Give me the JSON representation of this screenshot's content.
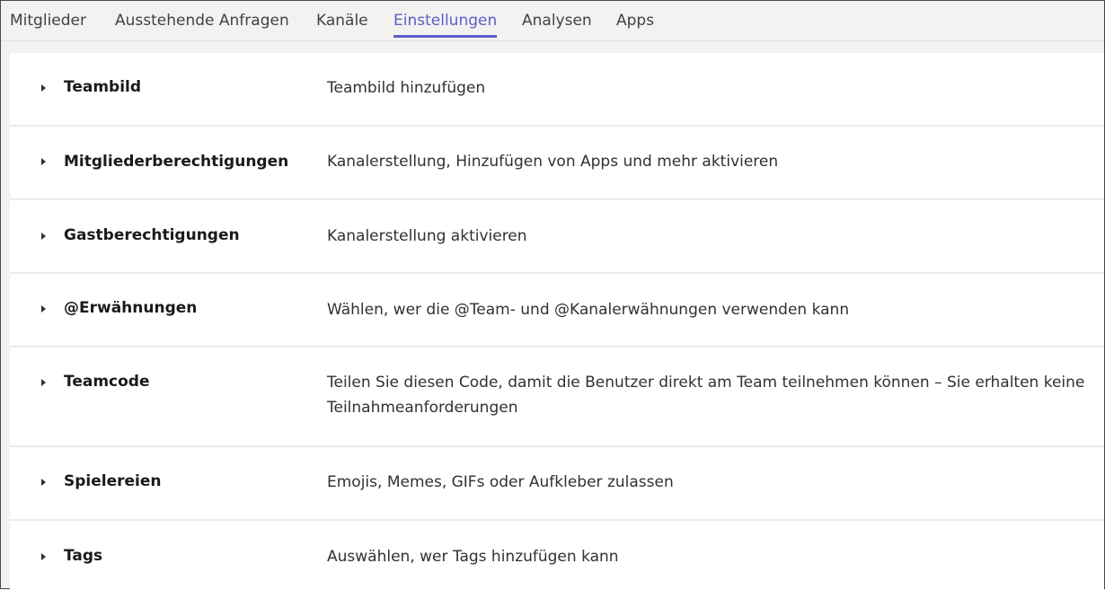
{
  "tabs": [
    {
      "label": "Mitglieder"
    },
    {
      "label": "Ausstehende Anfragen"
    },
    {
      "label": "Kanäle"
    },
    {
      "label": "Einstellungen"
    },
    {
      "label": "Analysen"
    },
    {
      "label": "Apps"
    }
  ],
  "active_tab": "Einstellungen",
  "settings": [
    {
      "title": "Teambild",
      "description": "Teambild hinzufügen"
    },
    {
      "title": "Mitgliederberechtigungen",
      "description": "Kanalerstellung, Hinzufügen von Apps und mehr aktivieren"
    },
    {
      "title": "Gastberechtigungen",
      "description": "Kanalerstellung aktivieren"
    },
    {
      "title": "@Erwähnungen",
      "description": "Wählen, wer die @Team- und @Kanalerwähnungen verwenden kann"
    },
    {
      "title": "Teamcode",
      "description": "Teilen Sie diesen Code, damit die Benutzer direkt am Team teilnehmen können – Sie erhalten keine Teilnahmeanforderungen"
    },
    {
      "title": "Spielereien",
      "description": "Emojis, Memes, GIFs oder Aufkleber zulassen"
    },
    {
      "title": "Tags",
      "description": "Auswählen, wer Tags hinzufügen kann"
    }
  ],
  "colors": {
    "accent": "#5b5fc7",
    "background": "#f3f2f1",
    "panel": "#ffffff",
    "divider": "#ecebea"
  },
  "icons": {
    "expand": "chevron-right-icon"
  }
}
